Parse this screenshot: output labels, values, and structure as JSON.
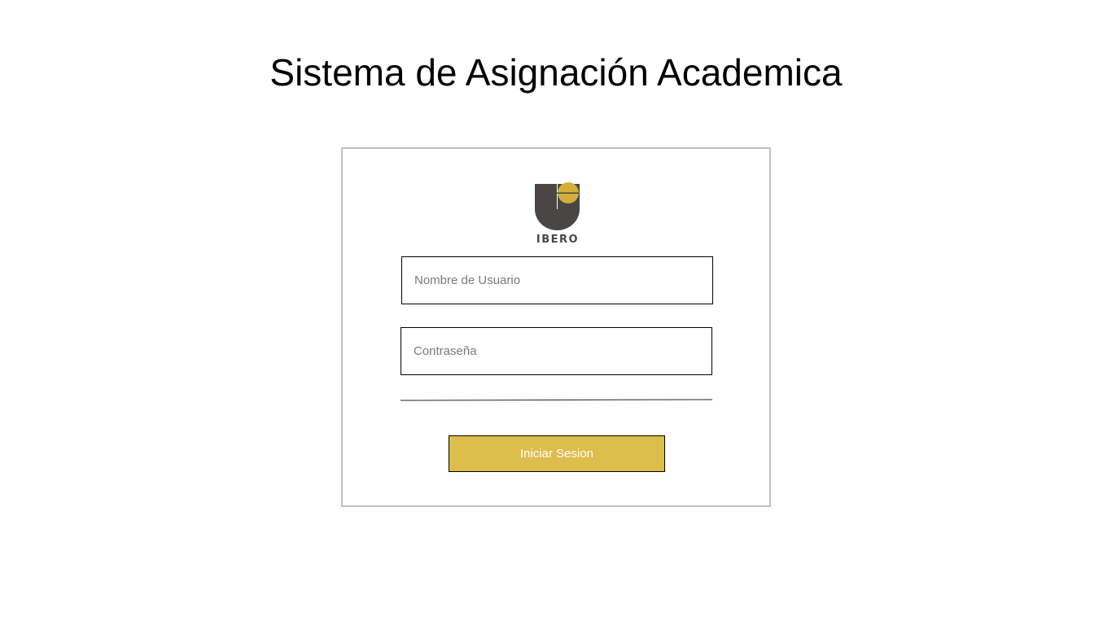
{
  "header": {
    "title": "Sistema de Asignación Academica"
  },
  "login": {
    "logo_text": "IBERO",
    "username": {
      "value": "",
      "placeholder": "Nombre de Usuario"
    },
    "password": {
      "value": "",
      "placeholder": "Contraseña"
    },
    "submit_label": "Iniciar Sesion"
  },
  "colors": {
    "accent": "#ddbd4b",
    "logo_dark": "#4a4646",
    "logo_gold": "#d4af37",
    "card_border": "#c0c0c0"
  },
  "icons": {
    "logo": "ibero-logo"
  }
}
